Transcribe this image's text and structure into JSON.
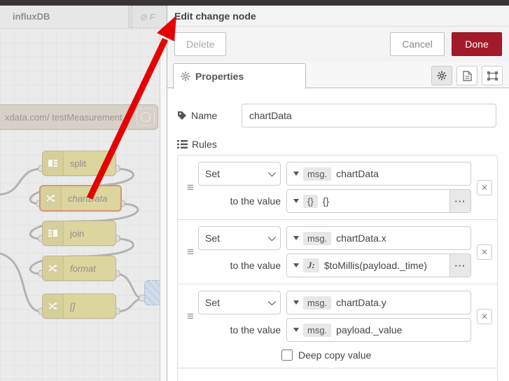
{
  "workspace": {
    "tabs": [
      {
        "label": "influxDB"
      },
      {
        "label": "⊘ F"
      }
    ],
    "nodes": {
      "influx": {
        "label": "xdata.com/ testMeasurement"
      },
      "split": {
        "label": "split"
      },
      "chartData": {
        "label": "chartData"
      },
      "join": {
        "label": "join"
      },
      "format": {
        "label": "format"
      },
      "brackets": {
        "label": "[]"
      }
    }
  },
  "panel": {
    "title": "Edit change node",
    "buttons": {
      "delete": "Delete",
      "cancel": "Cancel",
      "done": "Done"
    },
    "tab_label": "Properties",
    "name": {
      "label": "Name",
      "value": "chartData"
    },
    "rules_label": "Rules",
    "rules": [
      {
        "action": "Set",
        "property_type": "msg.",
        "property": "chartData",
        "to_label": "to the value",
        "value_type": "{}",
        "value": "{}"
      },
      {
        "action": "Set",
        "property_type": "msg.",
        "property": "chartData.x",
        "to_label": "to the value",
        "value_type": "J:",
        "value": "$toMillis(payload._time)"
      },
      {
        "action": "Set",
        "property_type": "msg.",
        "property": "chartData.y",
        "to_label": "to the value",
        "value_type": "msg.",
        "value": "payload._value",
        "deep_copy_label": "Deep copy value"
      }
    ],
    "colors": {
      "accent": "#a31b2a",
      "selected_node_border": "#c45a28",
      "arrow": "#e60000"
    }
  }
}
